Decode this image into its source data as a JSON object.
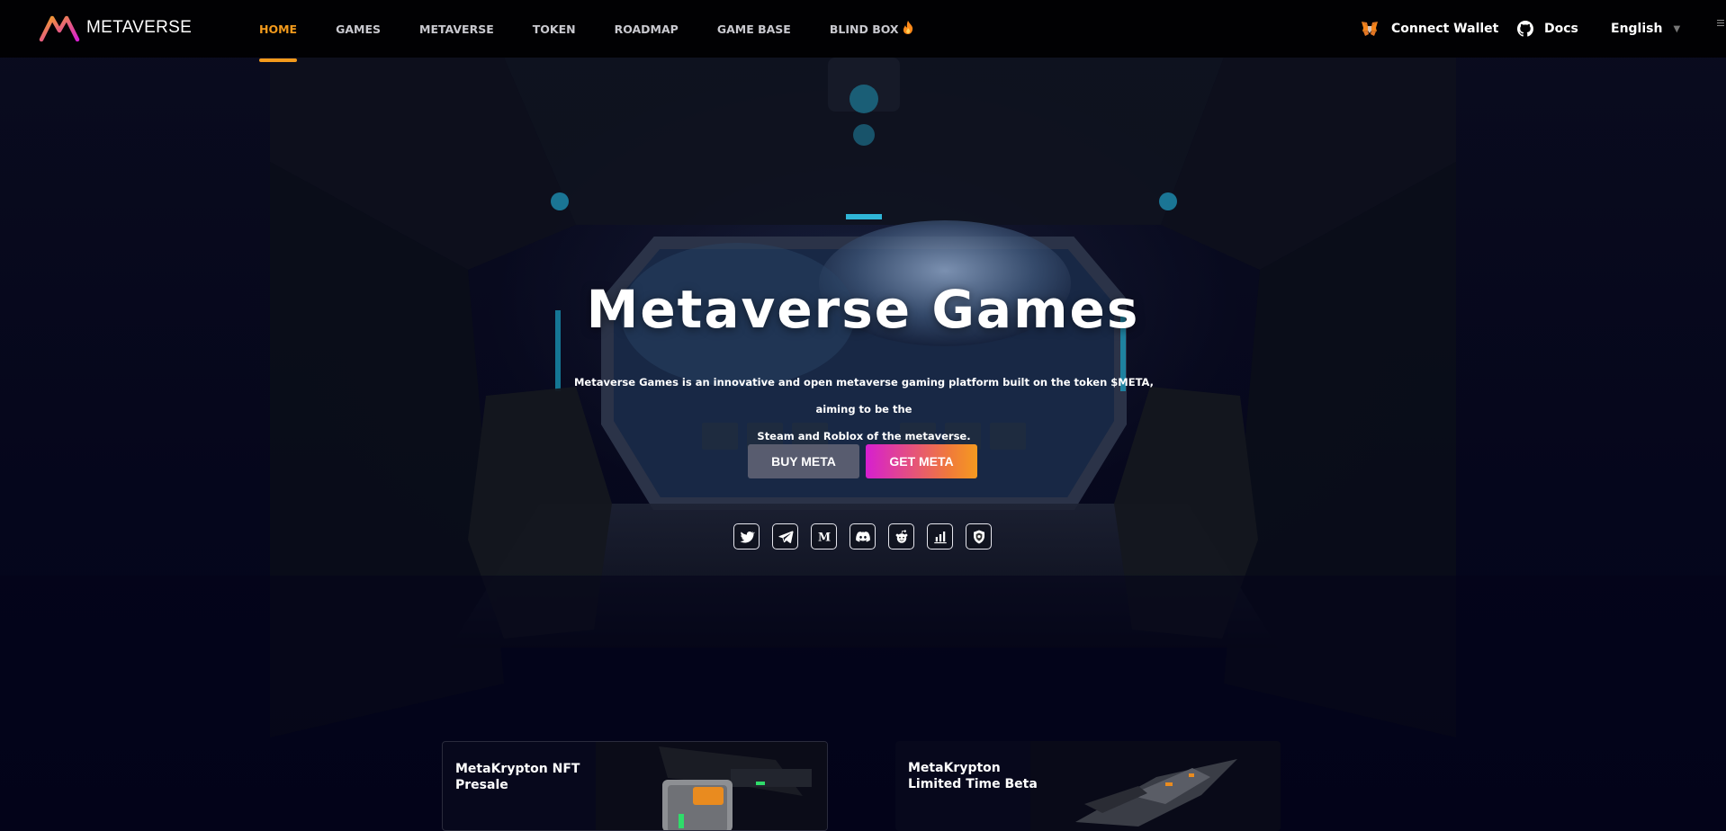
{
  "brand": {
    "name": "METAVERSE"
  },
  "nav": {
    "items": [
      {
        "label": "HOME",
        "active": true
      },
      {
        "label": "GAMES",
        "active": false
      },
      {
        "label": "METAVERSE",
        "active": false
      },
      {
        "label": "TOKEN",
        "active": false
      },
      {
        "label": "ROADMAP",
        "active": false
      },
      {
        "label": "GAME BASE",
        "active": false
      },
      {
        "label": "BLIND BOX",
        "active": false,
        "icon": "fire-icon"
      }
    ],
    "wallet_label": "Connect Wallet",
    "wallet_icon": "metamask-fox-icon",
    "docs_label": "Docs",
    "docs_icon": "github-icon",
    "language": "English"
  },
  "hero": {
    "title": "Metaverse Games",
    "description_line1": "Metaverse Games is an innovative and open metaverse gaming platform built on the token $META, aiming to be the",
    "description_line2": "Steam and Roblox of the metaverse.",
    "buy_label": "BUY META",
    "get_label": "GET META"
  },
  "socials": [
    {
      "name": "twitter-icon"
    },
    {
      "name": "telegram-icon"
    },
    {
      "name": "medium-icon"
    },
    {
      "name": "discord-icon"
    },
    {
      "name": "reddit-icon"
    },
    {
      "name": "chart-icon"
    },
    {
      "name": "shield-icon"
    }
  ],
  "cards": [
    {
      "title": "MetaKrypton NFT Presale"
    },
    {
      "title": "MetaKrypton Limited Time Beta"
    }
  ],
  "colors": {
    "accent": "#f39a1c",
    "get_gradient_start": "#d61fd0",
    "get_gradient_end": "#f59a20",
    "background": "#03041a"
  }
}
